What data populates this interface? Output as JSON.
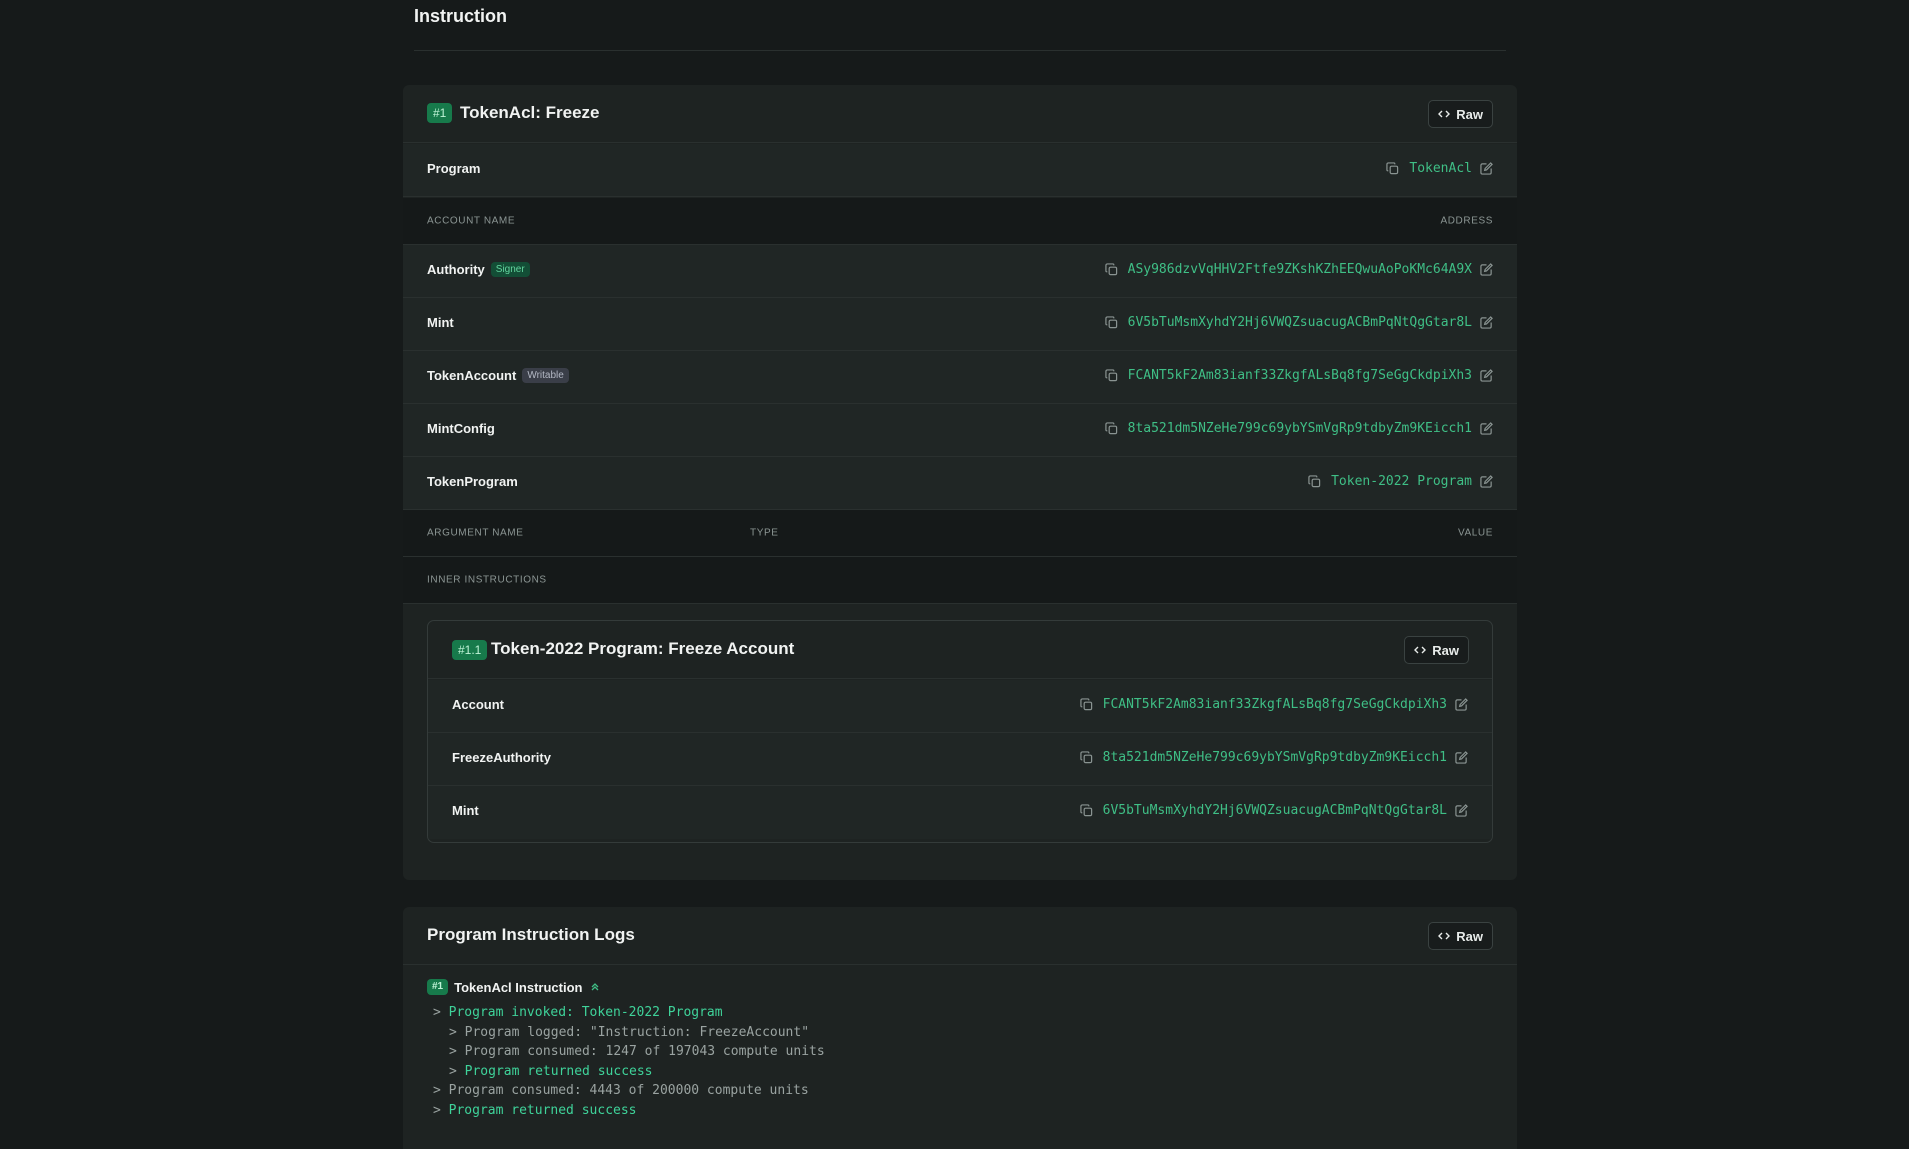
{
  "section": {
    "title": "Instruction"
  },
  "instruction": {
    "badge": "#1",
    "title": "TokenAcl: Freeze",
    "raw_label": "Raw",
    "program": {
      "label": "Program",
      "value": "TokenAcl"
    },
    "accounts_header": {
      "name": "ACCOUNT NAME",
      "address": "ADDRESS"
    },
    "accounts": [
      {
        "name": "Authority",
        "tag": "Signer",
        "address": "ASy986dzvVqHHV2Ftfe9ZKshKZhEEQwuAoPoKMc64A9X"
      },
      {
        "name": "Mint",
        "tag": "",
        "address": "6V5bTuMsmXyhdY2Hj6VWQZsuacugACBmPqNtQgGtar8L"
      },
      {
        "name": "TokenAccount",
        "tag": "Writable",
        "address": "FCANT5kF2Am83ianf33ZkgfALsBq8fg7SeGgCkdpiXh3"
      },
      {
        "name": "MintConfig",
        "tag": "",
        "address": "8ta521dm5NZeHe799c69ybYSmVgRp9tdbyZm9KEicch1"
      },
      {
        "name": "TokenProgram",
        "tag": "",
        "address": "Token-2022 Program"
      }
    ],
    "args_header": {
      "name": "ARGUMENT NAME",
      "type": "TYPE",
      "value": "VALUE"
    },
    "inner_header": "INNER INSTRUCTIONS",
    "inner": {
      "badge": "#1.1",
      "title": "Token-2022 Program: Freeze Account",
      "raw_label": "Raw",
      "accounts": [
        {
          "name": "Account",
          "address": "FCANT5kF2Am83ianf33ZkgfALsBq8fg7SeGgCkdpiXh3"
        },
        {
          "name": "FreezeAuthority",
          "address": "8ta521dm5NZeHe799c69ybYSmVgRp9tdbyZm9KEicch1"
        },
        {
          "name": "Mint",
          "address": "6V5bTuMsmXyhdY2Hj6VWQZsuacugACBmPqNtQgGtar8L"
        }
      ]
    }
  },
  "logs": {
    "title": "Program Instruction Logs",
    "raw_label": "Raw",
    "group": {
      "badge": "#1",
      "title": "TokenAcl Instruction",
      "chevron": "chevron-up-icon"
    },
    "lines": [
      {
        "text": "> Program invoked: Token-2022 Program",
        "indent": 0,
        "color": "green"
      },
      {
        "text": "> Program logged: \"Instruction: FreezeAccount\"",
        "indent": 1,
        "color": "gray"
      },
      {
        "text": "> Program consumed: 1247 of 197043 compute units",
        "indent": 1,
        "color": "gray"
      },
      {
        "text": "> Program returned success",
        "indent": 1,
        "color": "green"
      },
      {
        "text": "> Program consumed: 4443 of 200000 compute units",
        "indent": 0,
        "color": "gray"
      },
      {
        "text": "> Program returned success",
        "indent": 0,
        "color": "green"
      }
    ]
  },
  "colors": {
    "accent": "#3fbf86",
    "badge": "#177a4b",
    "background": "#161a1a",
    "card": "#1e2322"
  },
  "icons": {
    "copy": "copy-icon",
    "external": "external-link-icon",
    "code": "code-icon"
  }
}
